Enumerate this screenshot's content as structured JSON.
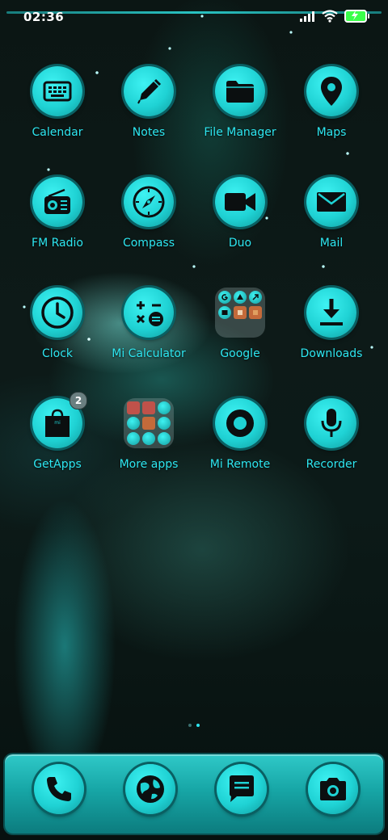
{
  "status_bar": {
    "time": "02:36",
    "icons": [
      "signal-icon",
      "wifi-icon",
      "battery-charging-icon"
    ]
  },
  "apps": [
    {
      "label": "Calendar",
      "icon": "keyboard-icon"
    },
    {
      "label": "Notes",
      "icon": "pen-icon"
    },
    {
      "label": "File Manager",
      "icon": "folder-icon"
    },
    {
      "label": "Maps",
      "icon": "map-pin-icon"
    },
    {
      "label": "FM Radio",
      "icon": "radio-icon"
    },
    {
      "label": "Compass",
      "icon": "compass-icon"
    },
    {
      "label": "Duo",
      "icon": "video-camera-icon"
    },
    {
      "label": "Mail",
      "icon": "envelope-icon"
    },
    {
      "label": "Clock",
      "icon": "clock-icon"
    },
    {
      "label": "Mi Calculator",
      "icon": "calculator-icon"
    },
    {
      "label": "Google",
      "icon": "folder-icon"
    },
    {
      "label": "Downloads",
      "icon": "download-icon"
    },
    {
      "label": "GetApps",
      "icon": "shopping-bag-icon",
      "badge": "2"
    },
    {
      "label": "More apps",
      "icon": "folder-icon"
    },
    {
      "label": "Mi Remote",
      "icon": "remote-icon"
    },
    {
      "label": "Recorder",
      "icon": "microphone-icon"
    }
  ],
  "dock": [
    {
      "icon": "phone-icon"
    },
    {
      "icon": "globe-icon"
    },
    {
      "icon": "message-icon"
    },
    {
      "icon": "camera-icon"
    }
  ],
  "page_indicator": {
    "pages": 2,
    "current": 2
  },
  "colors": {
    "accent": "#2de6f0",
    "icon_fill": "#1fd2d4",
    "glyph": "#0b0f10"
  }
}
